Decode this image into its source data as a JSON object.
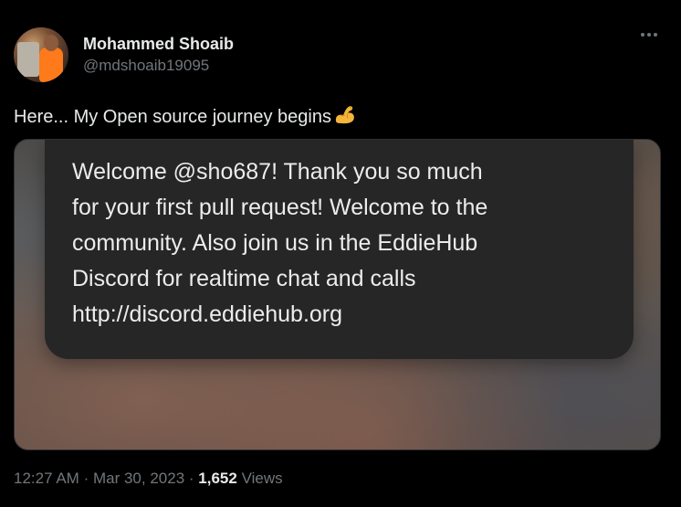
{
  "author": {
    "display_name": "Mohammed Shoaib",
    "handle": "@mdshoaib19095"
  },
  "tweet": {
    "text": "Here... My Open source journey begins",
    "emoji_icon": "flexed-biceps-emoji"
  },
  "media": {
    "message_lines": [
      "Welcome @sho687! Thank you so much",
      "for your first pull request! Welcome to the",
      "community. Also join us in the EddieHub",
      "Discord for realtime chat and calls",
      "http://discord.eddiehub.org"
    ]
  },
  "meta": {
    "time": "12:27 AM",
    "separator": "·",
    "date": "Mar 30, 2023",
    "views_count": "1,652",
    "views_label": "Views"
  },
  "colors": {
    "background": "#000000",
    "primary_text": "#e7e9ea",
    "secondary_text": "#71767b",
    "bubble": "#262626"
  }
}
